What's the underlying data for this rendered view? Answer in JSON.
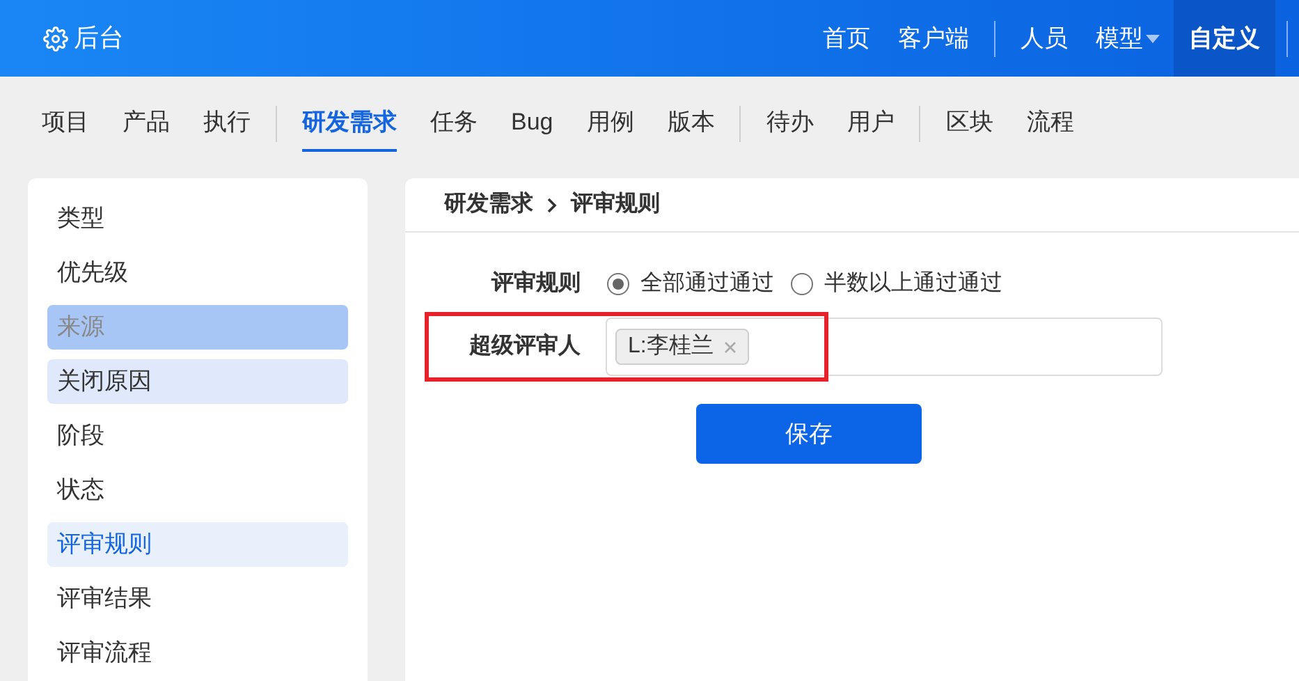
{
  "top_bar": {
    "brand": "后台",
    "nav_groups": [
      {
        "items": [
          {
            "label": "首页",
            "selected": false,
            "dropdown": false
          },
          {
            "label": "客户端",
            "selected": false,
            "dropdown": false
          }
        ]
      },
      {
        "items": [
          {
            "label": "人员",
            "selected": false,
            "dropdown": false
          },
          {
            "label": "模型",
            "selected": false,
            "dropdown": true
          },
          {
            "label": "自定义",
            "selected": true,
            "dropdown": false
          }
        ]
      }
    ]
  },
  "tab_groups": [
    {
      "tabs": [
        {
          "label": "项目",
          "selected": false
        },
        {
          "label": "产品",
          "selected": false
        },
        {
          "label": "执行",
          "selected": false
        }
      ]
    },
    {
      "tabs": [
        {
          "label": "研发需求",
          "selected": true
        },
        {
          "label": "任务",
          "selected": false
        },
        {
          "label": "Bug",
          "selected": false
        },
        {
          "label": "用例",
          "selected": false
        },
        {
          "label": "版本",
          "selected": false
        }
      ]
    },
    {
      "tabs": [
        {
          "label": "待办",
          "selected": false
        },
        {
          "label": "用户",
          "selected": false
        }
      ]
    },
    {
      "tabs": [
        {
          "label": "区块",
          "selected": false
        },
        {
          "label": "流程",
          "selected": false
        }
      ]
    }
  ],
  "sidebar": {
    "items": [
      {
        "label": "类型",
        "selected": false,
        "hovered": false,
        "focused": false
      },
      {
        "label": "优先级",
        "selected": false,
        "hovered": false,
        "focused": false
      },
      {
        "label": "来源",
        "selected": false,
        "hovered": true,
        "focused": false
      },
      {
        "label": "关闭原因",
        "selected": false,
        "hovered": false,
        "focused": true
      },
      {
        "label": "阶段",
        "selected": false,
        "hovered": false,
        "focused": false
      },
      {
        "label": "状态",
        "selected": false,
        "hovered": false,
        "focused": false
      },
      {
        "label": "评审规则",
        "selected": true,
        "hovered": false,
        "focused": false
      },
      {
        "label": "评审结果",
        "selected": false,
        "hovered": false,
        "focused": false
      },
      {
        "label": "评审流程",
        "selected": false,
        "hovered": false,
        "focused": false
      }
    ]
  },
  "breadcrumb": [
    "研发需求",
    "评审规则"
  ],
  "form": {
    "review_rule": {
      "label": "评审规则",
      "options": [
        {
          "label": "全部通过通过",
          "selected": true
        },
        {
          "label": "半数以上通过通过",
          "selected": false
        }
      ]
    },
    "super_reviewer": {
      "label": "超级评审人",
      "tags": [
        "L:李桂兰"
      ],
      "outlined": true
    },
    "save_button": "保存"
  }
}
